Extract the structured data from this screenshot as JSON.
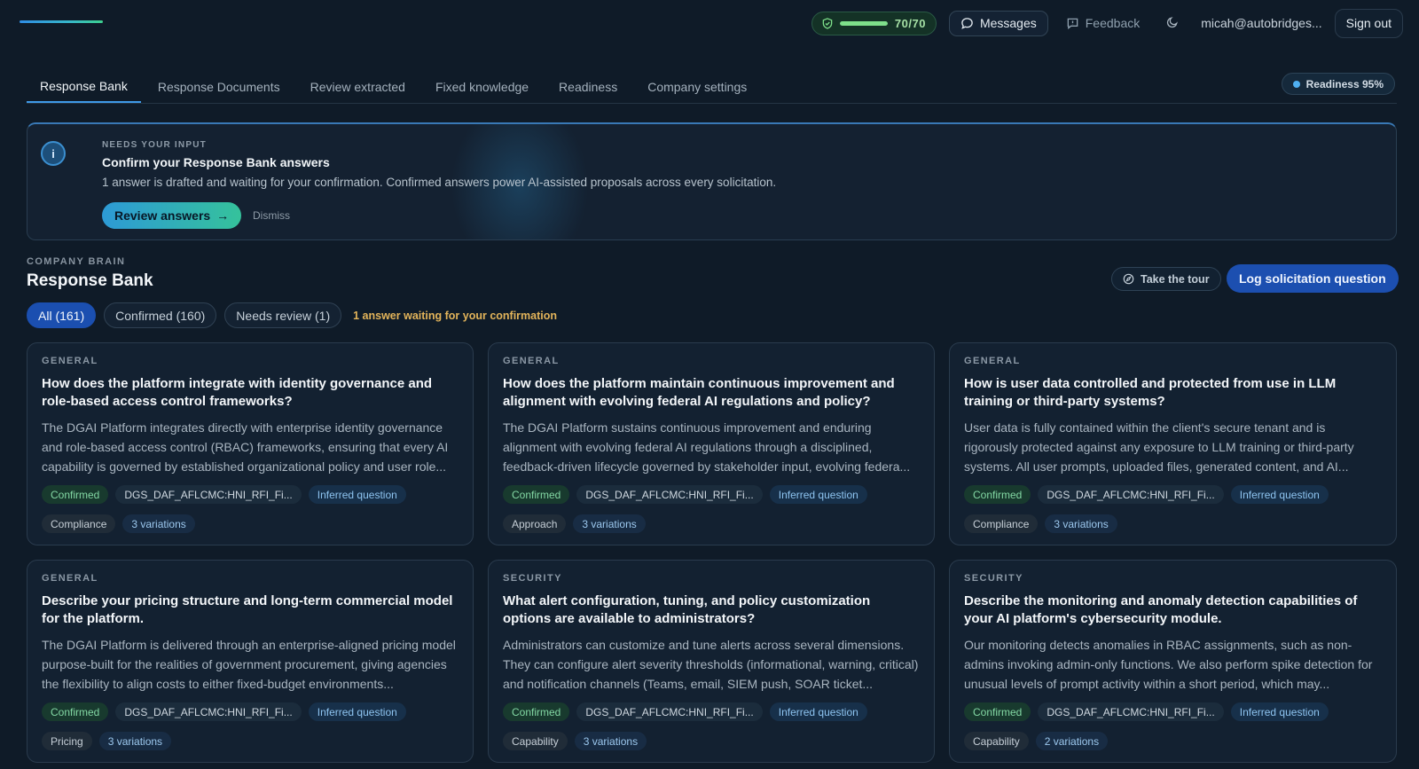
{
  "topbar": {
    "progress_label": "70/70",
    "progress_fraction": 1.0,
    "messages_label": "Messages",
    "feedback_label": "Feedback",
    "user_email": "micah@autobridges...",
    "signout_label": "Sign out",
    "icons": {
      "progress": "shield-check-icon",
      "messages": "chat-bubble-icon",
      "feedback": "feedback-icon",
      "theme": "moon-icon"
    }
  },
  "tabs": [
    {
      "label": "Response Bank",
      "active": true
    },
    {
      "label": "Response Documents",
      "active": false
    },
    {
      "label": "Review extracted",
      "active": false
    },
    {
      "label": "Fixed knowledge",
      "active": false
    },
    {
      "label": "Readiness",
      "active": false
    },
    {
      "label": "Company settings",
      "active": false
    }
  ],
  "readiness_badge": "Readiness 95%",
  "banner": {
    "eyebrow": "NEEDS YOUR INPUT",
    "title": "Confirm your Response Bank answers",
    "description": "1 answer is drafted and waiting for your confirmation. Confirmed answers power AI-assisted proposals across every solicitation.",
    "review_label": "Review answers",
    "dismiss_label": "Dismiss"
  },
  "section": {
    "eyebrow": "COMPANY BRAIN",
    "title": "Response Bank",
    "tour_label": "Take the tour",
    "log_label": "Log solicitation question"
  },
  "filters": {
    "chips": [
      {
        "label": "All (161)",
        "active": true
      },
      {
        "label": "Confirmed (160)",
        "active": false
      },
      {
        "label": "Needs review (1)",
        "active": false
      }
    ],
    "note": "1 answer waiting for your confirmation"
  },
  "cards": [
    {
      "category": "GENERAL",
      "question": "How does the platform integrate with identity governance and role-based access control frameworks?",
      "answer": "The DGAI Platform integrates directly with enterprise identity governance and role-based access control (RBAC) frameworks, ensuring that every AI capability is governed by established organizational policy and user role...",
      "status": "Confirmed",
      "source": "DGS_DAF_AFLCMC:HNI_RFI_Fi...",
      "inferred": "Inferred question",
      "topic": "Compliance",
      "variations": "3 variations"
    },
    {
      "category": "GENERAL",
      "question": "How does the platform maintain continuous improvement and alignment with evolving federal AI regulations and policy?",
      "answer": "The DGAI Platform sustains continuous improvement and enduring alignment with evolving federal AI regulations through a disciplined, feedback-driven lifecycle governed by stakeholder input, evolving federa...",
      "status": "Confirmed",
      "source": "DGS_DAF_AFLCMC:HNI_RFI_Fi...",
      "inferred": "Inferred question",
      "topic": "Approach",
      "variations": "3 variations"
    },
    {
      "category": "GENERAL",
      "question": "How is user data controlled and protected from use in LLM training or third-party systems?",
      "answer": "User data is fully contained within the client's secure tenant and is rigorously protected against any exposure to LLM training or third-party systems. All user prompts, uploaded files, generated content, and AI...",
      "status": "Confirmed",
      "source": "DGS_DAF_AFLCMC:HNI_RFI_Fi...",
      "inferred": "Inferred question",
      "topic": "Compliance",
      "variations": "3 variations"
    },
    {
      "category": "GENERAL",
      "question": "Describe your pricing structure and long-term commercial model for the platform.",
      "answer": "The DGAI Platform is delivered through an enterprise-aligned pricing model purpose-built for the realities of government procurement, giving agencies the flexibility to align costs to either fixed-budget environments...",
      "status": "Confirmed",
      "source": "DGS_DAF_AFLCMC:HNI_RFI_Fi...",
      "inferred": "Inferred question",
      "topic": "Pricing",
      "variations": "3 variations"
    },
    {
      "category": "SECURITY",
      "question": "What alert configuration, tuning, and policy customization options are available to administrators?",
      "answer": "Administrators can customize and tune alerts across several dimensions. They can configure alert severity thresholds (informational, warning, critical) and notification channels (Teams, email, SIEM push, SOAR ticket...",
      "status": "Confirmed",
      "source": "DGS_DAF_AFLCMC:HNI_RFI_Fi...",
      "inferred": "Inferred question",
      "topic": "Capability",
      "variations": "3 variations"
    },
    {
      "category": "SECURITY",
      "question": "Describe the monitoring and anomaly detection capabilities of your AI platform's cybersecurity module.",
      "answer": "Our monitoring detects anomalies in RBAC assignments, such as non-admins invoking admin-only functions. We also perform spike detection for unusual levels of prompt activity within a short period, which may...",
      "status": "Confirmed",
      "source": "DGS_DAF_AFLCMC:HNI_RFI_Fi...",
      "inferred": "Inferred question",
      "topic": "Capability",
      "variations": "2 variations"
    }
  ]
}
